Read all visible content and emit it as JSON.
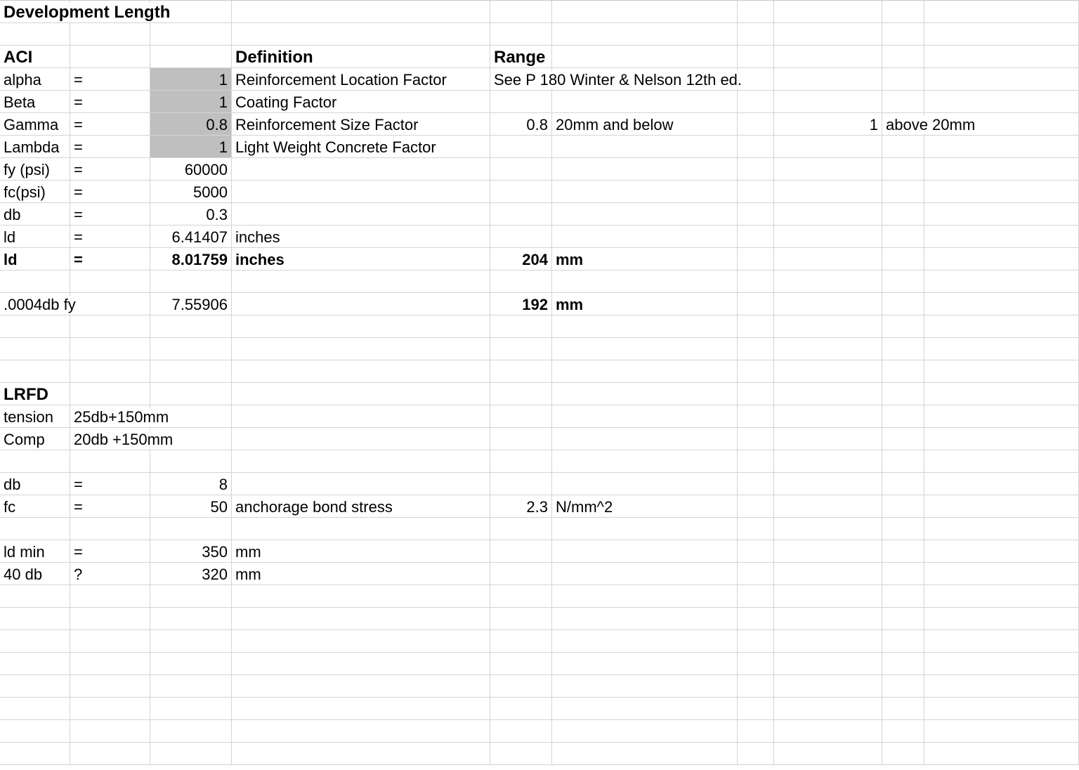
{
  "title": "Development Length",
  "aci": {
    "heading": "ACI",
    "definition_header": "Definition",
    "range_header": "Range",
    "rows": {
      "alpha": {
        "label": "alpha",
        "eq": "=",
        "val": "1",
        "def": "Reinforcement Location Factor",
        "range": "See P 180 Winter & Nelson 12th ed."
      },
      "beta": {
        "label": "Beta",
        "eq": "=",
        "val": "1",
        "def": "Coating Factor"
      },
      "gamma": {
        "label": "Gamma",
        "eq": "=",
        "val": "0.8",
        "def": "Reinforcement Size Factor",
        "r1_val": "0.8",
        "r1_txt": "20mm and below",
        "r2_val": "1",
        "r2_txt": "above 20mm"
      },
      "lambda": {
        "label": "Lambda",
        "eq": "=",
        "val": "1",
        "def": "Light Weight Concrete Factor"
      },
      "fy": {
        "label": "fy (psi)",
        "eq": "=",
        "val": "60000"
      },
      "fc": {
        "label": "fc(psi)",
        "eq": "=",
        "val": "5000"
      },
      "db": {
        "label": "db",
        "eq": "=",
        "val": "0.3"
      },
      "ld1": {
        "label": "ld",
        "eq": "=",
        "val": "6.41407",
        "unit": "inches"
      },
      "ld2": {
        "label": "ld",
        "eq": "=",
        "val": "8.01759",
        "unit": "inches",
        "mm_val": "204",
        "mm_unit": "mm"
      }
    },
    "dbfy": {
      "label": ".0004db fy",
      "val": "7.55906",
      "mm_val": "192",
      "mm_unit": "mm"
    }
  },
  "lrfd": {
    "heading": "LRFD",
    "tension": {
      "label": "tension",
      "formula": "25db+150mm"
    },
    "comp": {
      "label": "Comp",
      "formula": "20db +150mm"
    },
    "db": {
      "label": "db",
      "eq": "=",
      "val": "8"
    },
    "fc": {
      "label": "fc",
      "eq": "=",
      "val": "50",
      "def": "anchorage bond stress",
      "r_val": "2.3",
      "r_unit": "N/mm^2"
    },
    "ldmin": {
      "label": "ld min",
      "eq": "=",
      "val": "350",
      "unit": "mm"
    },
    "fortydb": {
      "label": "40 db",
      "eq": "?",
      "val": "320",
      "unit": "mm"
    }
  }
}
